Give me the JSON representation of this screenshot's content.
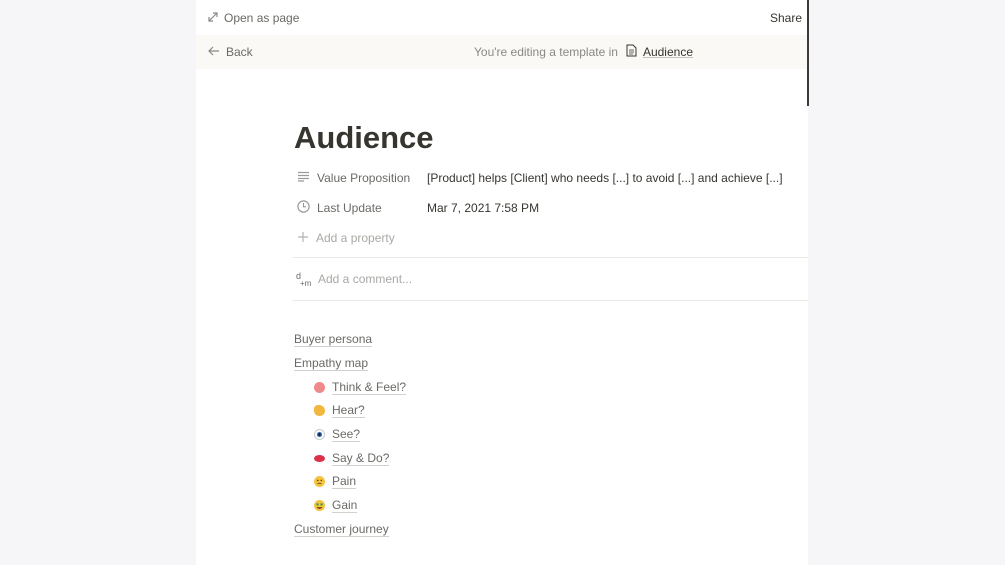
{
  "topbar": {
    "open_as_page": "Open as page",
    "share": "Share",
    "expand_icon": "expand-icon"
  },
  "banner": {
    "back": "Back",
    "text": "You're editing a template in",
    "page_name": "Audience",
    "page_icon": "page-icon"
  },
  "page": {
    "title": "Audience",
    "properties": [
      {
        "label": "Value Proposition",
        "value": "[Product] helps [Client] who needs [...] to avoid [...] and achieve [...]",
        "icon": "text-lines-icon"
      },
      {
        "label": "Last Update",
        "value": "Mar 7, 2021 7:58 PM",
        "icon": "clock-icon"
      }
    ],
    "add_property": "Add a property",
    "comment_placeholder": "Add a comment..."
  },
  "links": {
    "buyer_persona": "Buyer persona",
    "empathy_map": "Empathy map",
    "think_feel": "Think & Feel?",
    "hear": "Hear?",
    "see": "See?",
    "say_do": "Say & Do?",
    "pain": "Pain",
    "gain": "Gain",
    "customer_journey": "Customer journey"
  },
  "colors": {
    "panel_bg": "#ffffff",
    "page_bg": "#f6f6f8",
    "banner_bg": "#fbf9f5",
    "text": "#37352f",
    "muted": "#6b6a66"
  }
}
